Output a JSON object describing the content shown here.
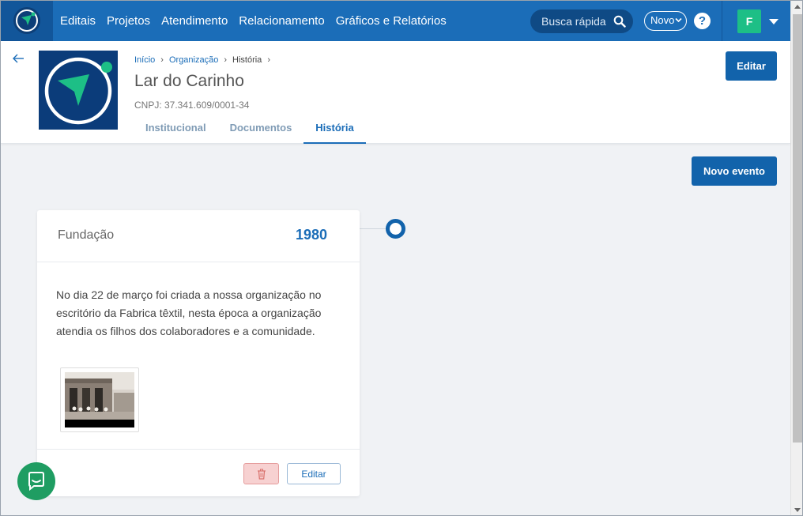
{
  "navbar": {
    "links": [
      "Editais",
      "Projetos",
      "Atendimento",
      "Relacionamento",
      "Gráficos e Relatórios"
    ],
    "search_placeholder": "Busca rápida",
    "novo_label": "Novo",
    "help_label": "?",
    "avatar_initial": "F"
  },
  "header": {
    "breadcrumb": {
      "home": "Início",
      "organization": "Organização",
      "current": "História"
    },
    "org_name": "Lar do Carinho",
    "cnpj": "CNPJ: 37.341.609/0001-34",
    "tabs": [
      {
        "label": "Institucional",
        "active": false
      },
      {
        "label": "Documentos",
        "active": false
      },
      {
        "label": "História",
        "active": true
      }
    ],
    "edit_label": "Editar"
  },
  "new_event_label": "Novo evento",
  "event": {
    "title": "Fundação",
    "year": "1980",
    "description": "No dia 22 de março foi criada a nossa organização no escritório da Fabrica têxtil, nesta época a organização atendia os filhos dos colaboradores e a comunidade.",
    "edit_label": "Editar"
  },
  "colors": {
    "primary": "#1263ab",
    "navbar": "#1b6db8",
    "brand_green": "#1dbf86",
    "delete_bg": "#f7d1d1"
  }
}
